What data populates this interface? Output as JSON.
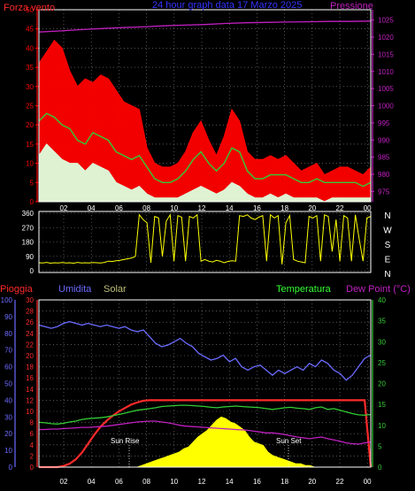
{
  "colors": {
    "background": "#000000",
    "frame": "#ffffff",
    "grid": "#8a8a8a",
    "wind_speed": "#ff0000",
    "wind_avg": "#33cc33",
    "wind_low": "#ddffdd",
    "pressure": "#c020c0",
    "direction": "#ffff00",
    "humidity": "#6b6bff",
    "rain": "#ff2a2a",
    "solar": "#ffff00",
    "temperature": "#33cc33",
    "dew_point": "#c020c0",
    "title": "#3333ff"
  },
  "x_ticks": [
    "02",
    "04",
    "06",
    "08",
    "10",
    "12",
    "14",
    "16",
    "18",
    "20",
    "22",
    "00"
  ],
  "chart_data": [
    {
      "type": "line",
      "title": "24 hour graph data  17 Marzo 2025",
      "left_label": "Forza vento",
      "right_label": "Pressione",
      "x_ticks": [
        "02",
        "04",
        "06",
        "08",
        "10",
        "12",
        "14",
        "16",
        "18",
        "20",
        "22",
        "00"
      ],
      "y_left_ticks": [
        0,
        5,
        10,
        15,
        20,
        25,
        30,
        35,
        40,
        45,
        50
      ],
      "y_right_ticks": [
        975,
        980,
        985,
        990,
        995,
        1000,
        1005,
        1010,
        1015,
        1020,
        1025
      ],
      "ylim_left": [
        0,
        50
      ],
      "ylim_right": [
        972,
        1028
      ],
      "series": [
        {
          "name": "Forza vento",
          "color": "#ff0000",
          "axis": "left",
          "values": [
            36,
            39,
            42,
            40,
            34,
            30,
            32,
            31,
            33,
            32,
            29,
            26,
            25,
            24,
            14,
            10,
            9,
            9,
            10,
            13,
            18,
            21,
            16,
            12,
            17,
            24,
            21,
            13,
            11,
            11,
            12,
            11,
            12,
            10,
            8,
            9,
            10,
            7,
            8,
            9,
            9,
            8,
            7,
            9
          ]
        },
        {
          "color": "#33cc33",
          "axis": "left",
          "values": [
            21,
            23,
            22,
            20,
            19,
            16,
            15,
            18,
            17,
            16,
            13,
            12,
            11,
            12,
            9,
            6,
            5,
            5,
            6,
            8,
            11,
            13,
            10,
            8,
            10,
            14,
            13,
            8,
            6,
            6,
            7,
            7,
            7,
            6,
            5,
            5,
            6,
            5,
            5,
            5,
            5,
            5,
            4,
            5
          ]
        },
        {
          "color": "#ddffdd",
          "axis": "left",
          "values": [
            12,
            15,
            13,
            11,
            10,
            10,
            8,
            10,
            9,
            8,
            5,
            4,
            3,
            4,
            2,
            1,
            1,
            1,
            1,
            2,
            3,
            4,
            3,
            2,
            3,
            5,
            4,
            2,
            1,
            1,
            2,
            1,
            2,
            1,
            1,
            1,
            1,
            0,
            1,
            1,
            1,
            1,
            1,
            1
          ]
        },
        {
          "name": "Pressione",
          "color": "#c020c0",
          "axis": "right",
          "values": [
            1021.5,
            1021.8,
            1022.2,
            1022.5,
            1022.8,
            1023.0,
            1023.3,
            1023.5,
            1023.7,
            1024.0,
            1024.2,
            1024.3,
            1024.4,
            1024.5,
            1024.6,
            1024.6,
            1024.7
          ]
        }
      ]
    },
    {
      "type": "scatter",
      "y_ticks": [
        0,
        90,
        180,
        270,
        360
      ],
      "ylim": [
        0,
        360
      ],
      "right_labels": [
        "N",
        "W",
        "S",
        "E",
        "N"
      ],
      "series": [
        {
          "color": "#ffff00",
          "values": [
            50,
            48,
            52,
            47,
            50,
            49,
            51,
            48,
            50,
            47,
            52,
            49,
            50,
            48,
            51,
            50,
            49,
            52,
            60,
            58,
            62,
            65,
            70,
            75,
            80,
            90,
            350,
            320,
            300,
            50,
            340,
            330,
            90,
            310,
            350,
            60,
            345,
            335,
            60,
            340,
            330,
            350,
            60,
            70,
            60,
            55,
            65,
            60,
            50,
            58,
            62,
            60,
            345,
            340,
            350,
            330,
            320,
            335,
            345,
            60,
            350,
            330,
            345,
            40,
            300,
            345,
            70,
            60,
            55,
            50,
            340,
            330,
            345,
            60,
            350,
            340,
            120,
            320,
            60,
            345,
            330,
            60,
            350,
            200,
            60,
            330,
            340
          ]
        }
      ]
    },
    {
      "type": "line",
      "left_label_rain": "Pioggia",
      "left_label_humidity": "Umidita",
      "solar_label": "Solar",
      "temperature_label": "Temperatura",
      "dew_point_label": "Dew Point (°C)",
      "sunrise_label": "Sun Rise",
      "sunset_label": "Sun Set",
      "x_ticks": [
        "02",
        "04",
        "06",
        "08",
        "10",
        "12",
        "14",
        "16",
        "18",
        "20",
        "22",
        "00"
      ],
      "y_humidity_ticks": [
        0,
        10,
        20,
        30,
        40,
        50,
        60,
        70,
        80,
        90,
        100
      ],
      "y_rain_ticks": [
        0,
        2,
        4,
        6,
        8,
        10,
        12,
        14,
        16,
        18,
        20,
        22,
        24,
        26,
        28,
        30
      ],
      "y_temp_ticks": [
        0,
        5,
        10,
        15,
        20,
        25,
        30,
        35,
        40
      ],
      "series": [
        {
          "name": "Umidita",
          "color": "#6b6bff",
          "values": [
            85,
            84,
            83,
            84,
            86,
            87,
            86,
            85,
            86,
            85,
            84,
            85,
            84,
            83,
            84,
            82,
            81,
            82,
            78,
            74,
            72,
            73,
            75,
            77,
            74,
            72,
            68,
            66,
            64,
            65,
            67,
            63,
            65,
            60,
            58,
            60,
            61,
            58,
            55,
            58,
            56,
            58,
            60,
            58,
            62,
            60,
            64,
            62,
            58,
            56,
            52,
            55,
            60,
            65,
            67
          ]
        },
        {
          "name": "Pioggia",
          "color": "#ff2a2a",
          "values": [
            0,
            0,
            0,
            0,
            0.2,
            0.6,
            1.4,
            2.6,
            4.2,
            5.8,
            7.2,
            8.3,
            9.2,
            10,
            10.6,
            11.2,
            11.6,
            11.9,
            12,
            12,
            12,
            12,
            12,
            12,
            12,
            12,
            12,
            12,
            12,
            12,
            12,
            12,
            12,
            12,
            12,
            12,
            12,
            12,
            12,
            12,
            12,
            12,
            12,
            12,
            12,
            12,
            12,
            12,
            12,
            12,
            12,
            12,
            12,
            12,
            0
          ]
        },
        {
          "name": "Temperatura",
          "color": "#33cc33",
          "values": [
            10.7,
            10.6,
            10.4,
            10.3,
            10.5,
            10.8,
            11.0,
            11.4,
            11.6,
            11.7,
            11.8,
            12.0,
            12.3,
            12.6,
            12.9,
            13.3,
            13.6,
            13.8,
            14.0,
            14.2,
            14.5,
            14.6,
            14.7,
            14.8,
            14.8,
            14.7,
            14.6,
            14.5,
            14.3,
            14.2,
            14.4,
            14.5,
            14.6,
            14.5,
            14.4,
            14.3,
            14.2,
            14.0,
            13.8,
            14.0,
            14.2,
            14.3,
            14.1,
            14.0,
            13.8,
            14.2,
            14.4,
            13.8,
            14.0,
            13.6,
            13.2,
            12.8,
            12.5,
            12.4,
            12.6
          ]
        },
        {
          "name": "Dew Point (°C)",
          "color": "#c020c0",
          "values": [
            9.0,
            9.0,
            9.1,
            9.1,
            9.2,
            9.3,
            9.4,
            9.5,
            9.5,
            9.6,
            9.7,
            9.8,
            10.0,
            10.2,
            10.4,
            10.6,
            10.8,
            10.9,
            11.0,
            11.0,
            10.8,
            10.6,
            10.3,
            10.0,
            9.8,
            9.7,
            9.6,
            9.5,
            9.4,
            9.3,
            9.2,
            9.1,
            9.0,
            8.9,
            8.8,
            8.6,
            8.4,
            8.2,
            8.2,
            8.0,
            7.8,
            7.5,
            7.2,
            7.0,
            6.8,
            7.0,
            7.2,
            6.8,
            6.5,
            6.2,
            5.8,
            5.6,
            5.5,
            5.8,
            6.0
          ]
        },
        {
          "name": "Solar",
          "color": "#ffff00",
          "values": [
            0,
            0,
            0,
            0,
            0,
            0,
            0,
            0,
            0,
            0,
            0,
            0,
            0,
            0,
            0,
            0,
            0,
            0,
            0,
            0,
            0,
            0,
            1,
            2,
            3,
            4,
            5,
            6,
            7,
            8,
            9,
            11,
            12,
            15,
            18,
            20,
            22,
            25,
            28,
            30,
            29,
            27,
            26,
            24,
            22,
            18,
            15,
            14,
            13,
            9,
            7,
            6,
            5,
            4,
            3,
            2,
            2,
            1,
            1,
            0,
            0,
            0,
            0,
            0,
            0,
            0,
            0,
            0,
            0,
            0,
            0,
            0
          ]
        }
      ]
    }
  ]
}
